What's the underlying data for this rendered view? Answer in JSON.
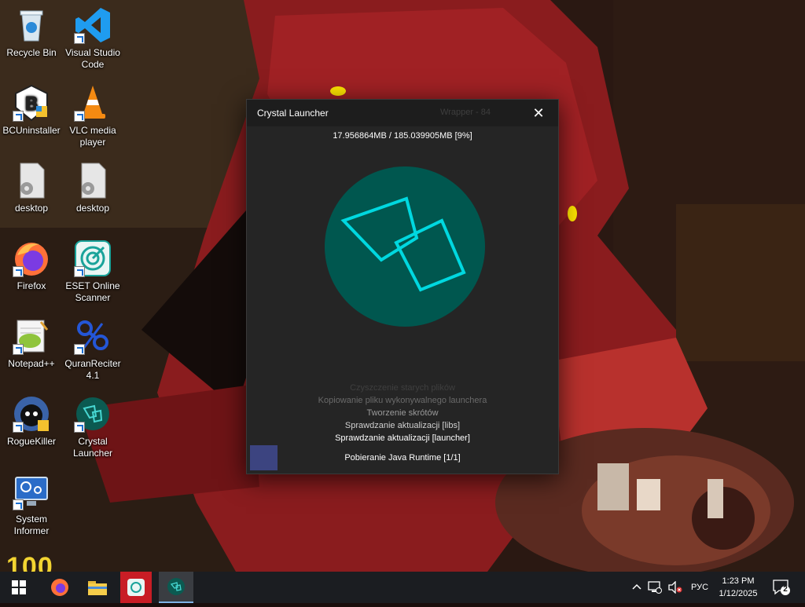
{
  "desktop": {
    "icons": [
      {
        "label": "Recycle Bin"
      },
      {
        "label": "Visual Studio Code"
      },
      {
        "label": "BCUninstaller"
      },
      {
        "label": "VLC media player"
      },
      {
        "label": "desktop"
      },
      {
        "label": "desktop"
      },
      {
        "label": "Firefox"
      },
      {
        "label": "ESET Online Scanner"
      },
      {
        "label": "Notepad++"
      },
      {
        "label": "QuranReciter 4.1"
      },
      {
        "label": "RogueKiller"
      },
      {
        "label": "Crystal Launcher"
      },
      {
        "label": "System Informer"
      }
    ],
    "wallpaper_text": "100"
  },
  "launcher": {
    "title": "Crystal Launcher",
    "title_faint": "Wrapper - 84",
    "close_label": "✕",
    "progress": "17.956864MB / 185.039905MB [9%]",
    "progress_percent": 9,
    "log": [
      {
        "text": "Czyszczenie starych plików",
        "color": "#3f3f3f"
      },
      {
        "text": "Kopiowanie pliku wykonywalnego launchera",
        "color": "#6a6a6a"
      },
      {
        "text": "Tworzenie skrótów",
        "color": "#9a9a9a"
      },
      {
        "text": "Sprawdzanie aktualizacji [libs]",
        "color": "#d0d0d0"
      },
      {
        "text": "Sprawdzanie aktualizacji [launcher]",
        "color": "#ffffff"
      }
    ],
    "status": "Pobieranie Java Runtime [1/1]",
    "accent": "#00c8d0",
    "circle_color": "#00574f"
  },
  "taskbar": {
    "items": [
      "start-icon",
      "firefox-icon",
      "file-explorer-icon",
      "app-red-icon",
      "crystal-launcher-icon"
    ],
    "language": "РУС",
    "time": "1:23 PM",
    "date": "1/12/2025",
    "notifications": "2"
  }
}
